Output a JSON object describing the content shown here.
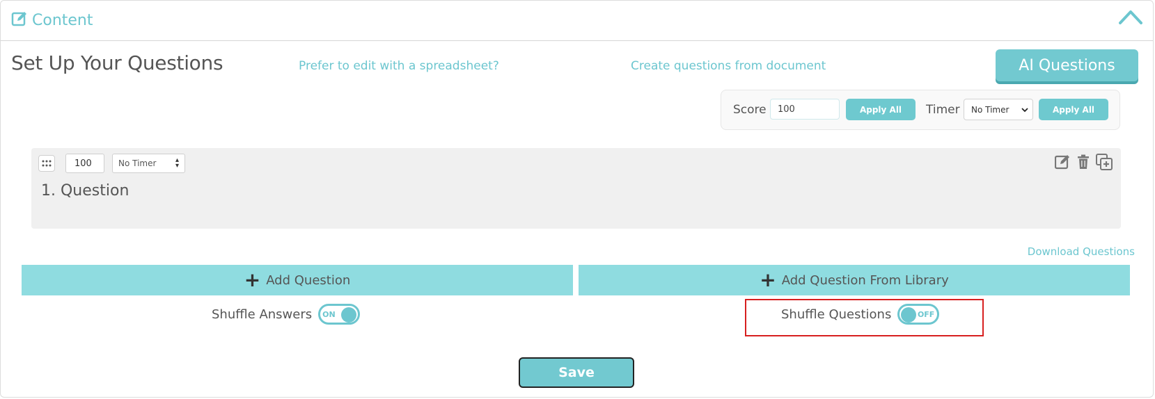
{
  "header": {
    "title": "Content",
    "title_icon": "edit-icon",
    "collapse_icon": "chevron-up-icon"
  },
  "main": {
    "title": "Set Up Your Questions",
    "spreadsheet_link": "Prefer to edit with a spreadsheet?",
    "document_link": "Create questions from document",
    "ai_button": "AI Questions"
  },
  "bulk": {
    "score_label": "Score",
    "score_value": "100",
    "apply_all_score": "Apply All",
    "timer_label": "Timer",
    "timer_value": "No Timer",
    "apply_all_timer": "Apply All"
  },
  "question": {
    "score": "100",
    "timer": "No Timer",
    "text": "1. Question",
    "icons": [
      "edit-icon",
      "trash-icon",
      "duplicate-icon"
    ]
  },
  "actions": {
    "download": "Download Questions",
    "add_question": "Add Question",
    "add_from_library": "Add Question From Library"
  },
  "shuffle": {
    "answers_label": "Shuffle Answers",
    "answers_state": "ON",
    "questions_label": "Shuffle Questions",
    "questions_state": "OFF"
  },
  "save_label": "Save",
  "colors": {
    "accent": "#6cc6cf",
    "add_bar": "#8fdce0",
    "highlight": "#d71f1f"
  }
}
